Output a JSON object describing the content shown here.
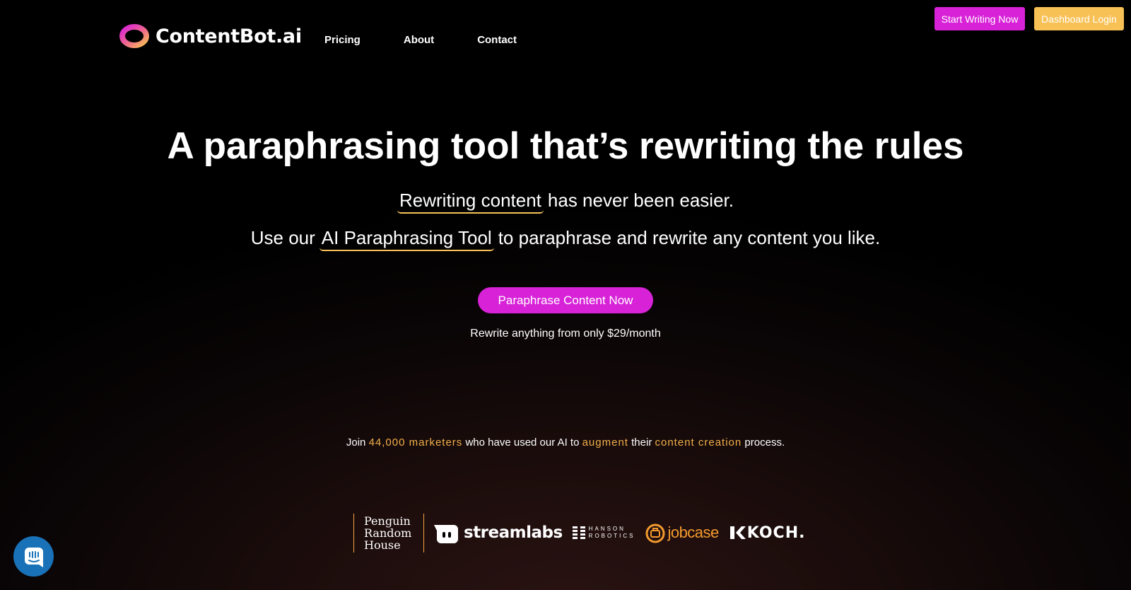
{
  "brand": {
    "name": "ContentBot.ai",
    "logo_icon": "ring-logo-icon",
    "colors": {
      "magenta": "#d822d8",
      "gold": "#f8c156",
      "orange": "#f3a241"
    }
  },
  "nav": {
    "items": [
      {
        "label": "Pricing"
      },
      {
        "label": "About"
      },
      {
        "label": "Contact"
      }
    ]
  },
  "header_buttons": {
    "start_writing": "Start Writing Now",
    "dashboard_login": "Dashboard Login"
  },
  "hero": {
    "title": "A paraphrasing tool that’s rewriting the rules",
    "line1_highlight": "Rewriting content",
    "line1_rest": "has never been easier.",
    "line2_prefix": "Use our",
    "line2_highlight": "AI Paraphrasing Tool",
    "line2_suffix": "to paraphrase and rewrite any content you like.",
    "cta": "Paraphrase Content Now",
    "price_note": "Rewrite anything from only $29/month"
  },
  "social_proof": {
    "join": "Join",
    "marketers": "44,000 marketers",
    "who": "who have used our AI to",
    "augment": "augment",
    "their": "their",
    "content_creation": "content creation",
    "process": "process."
  },
  "client_logos": {
    "penguin_line1": "Penguin",
    "penguin_line2": "Random",
    "penguin_line3": "House",
    "streamlabs": "streamlabs",
    "hanson_line1": "HANSON",
    "hanson_line2": "ROBOTICS",
    "jobcase": "jobcase",
    "koch": "KOCH."
  },
  "chat_widget": {
    "icon": "chat-bubble-icon"
  }
}
